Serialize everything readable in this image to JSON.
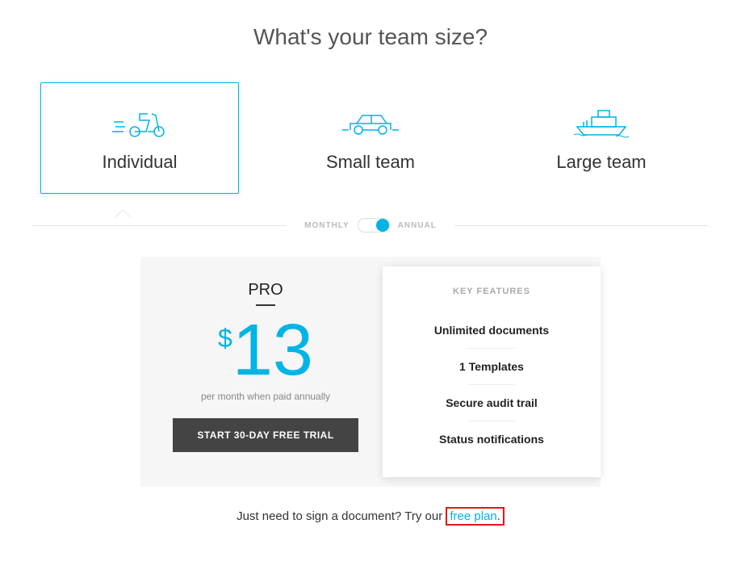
{
  "heading": "What's your team size?",
  "teamOptions": {
    "individual": "Individual",
    "smallTeam": "Small team",
    "largeTeam": "Large team"
  },
  "billing": {
    "monthly": "MONTHLY",
    "annual": "ANNUAL"
  },
  "plan": {
    "name": "PRO",
    "currency": "$",
    "price": "13",
    "sub": "per month when paid annually",
    "cta": "START 30-DAY FREE TRIAL"
  },
  "features": {
    "title": "KEY FEATURES",
    "items": {
      "f1": "Unlimited documents",
      "f2": "1 Templates",
      "f3": "Secure audit trail",
      "f4": "Status notifications"
    }
  },
  "footer": {
    "text": "Just need to sign a document? Try our ",
    "link": "free plan",
    "after": "."
  }
}
